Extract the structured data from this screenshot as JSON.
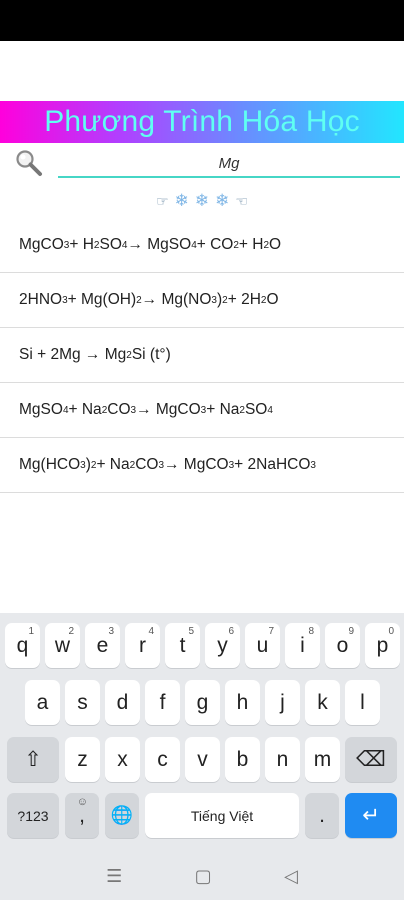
{
  "app": {
    "title": "Phương Trình Hóa Học"
  },
  "search": {
    "value": "Mg"
  },
  "decor": {
    "left": "☞",
    "flakes": [
      "❄",
      "❄",
      "❄"
    ],
    "right": "☜"
  },
  "equations": [
    {
      "parts": [
        "MgCO",
        "3",
        " + H",
        "2",
        "SO",
        "4",
        " → MgSO",
        "4",
        " + CO",
        "2",
        " + H",
        "2",
        "O"
      ]
    },
    {
      "parts": [
        "2HNO",
        "3",
        " + Mg(OH)",
        "2",
        " → Mg(NO",
        "3",
        ")",
        "2",
        " + 2H",
        "2",
        "O"
      ]
    },
    {
      "parts": [
        "Si + 2Mg → Mg",
        "2",
        "Si (t°)"
      ]
    },
    {
      "parts": [
        "MgSO",
        "4",
        " + Na",
        "2",
        "CO",
        "3",
        " → MgCO",
        "3",
        " + Na",
        "2",
        "SO",
        "4"
      ]
    },
    {
      "parts": [
        "Mg(HCO",
        "3",
        ")",
        "2",
        " + Na",
        "2",
        "CO",
        "3",
        " → MgCO",
        "3",
        " + 2NaHCO",
        "3"
      ]
    }
  ],
  "keyboard": {
    "row1": [
      {
        "label": "q",
        "hint": "1"
      },
      {
        "label": "w",
        "hint": "2"
      },
      {
        "label": "e",
        "hint": "3"
      },
      {
        "label": "r",
        "hint": "4"
      },
      {
        "label": "t",
        "hint": "5"
      },
      {
        "label": "y",
        "hint": "6"
      },
      {
        "label": "u",
        "hint": "7"
      },
      {
        "label": "i",
        "hint": "8"
      },
      {
        "label": "o",
        "hint": "9"
      },
      {
        "label": "p",
        "hint": "0"
      }
    ],
    "row2": [
      "a",
      "s",
      "d",
      "f",
      "g",
      "h",
      "j",
      "k",
      "l"
    ],
    "row3": [
      "z",
      "x",
      "c",
      "v",
      "b",
      "n",
      "m"
    ],
    "symbols_label": "?123",
    "comma_label": ",",
    "emoji_hint": "☺",
    "space_label": "Tiếng Việt",
    "period_label": ".",
    "shift_icon": "⇧",
    "backspace_icon": "⌫",
    "globe_icon": "🌐",
    "enter_icon": "↵"
  },
  "nav": {
    "menu_icon": "☰",
    "home_icon": "▢",
    "back_icon": "◁"
  }
}
